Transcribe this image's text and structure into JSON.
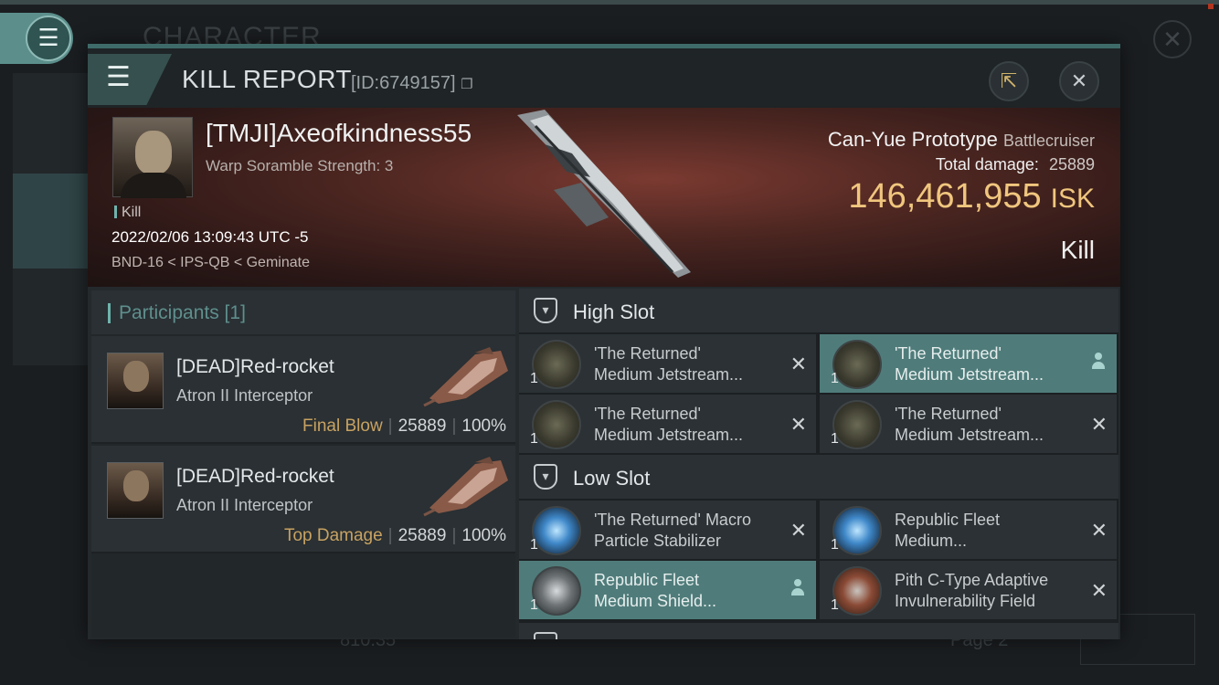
{
  "background": {
    "title": "CHARACTER",
    "ghost_value": "810.35",
    "ghost_page": "Page 2"
  },
  "header": {
    "title": "KILL REPORT",
    "id_label": "[ID:6749157]"
  },
  "victim": {
    "name": "[TMJI]Axeofkindness55",
    "detail": "Warp Soramble Strength: 3",
    "tag": "Kill",
    "datetime": "2022/02/06 13:09:43 UTC -5",
    "location": "BND-16 < IPS-QB < Geminate",
    "ship_name": "Can-Yue Prototype",
    "ship_class": "Battlecruiser",
    "total_damage_label": "Total damage:",
    "total_damage": "25889",
    "isk_value": "146,461,955",
    "isk_unit": "ISK",
    "result": "Kill"
  },
  "participants": {
    "header": "Participants [1]",
    "rows": [
      {
        "name": "[DEAD]Red-rocket",
        "ship": "Atron II Interceptor",
        "role": "Final Blow",
        "damage": "25889",
        "percent": "100%"
      },
      {
        "name": "[DEAD]Red-rocket",
        "ship": "Atron II Interceptor",
        "role": "Top Damage",
        "damage": "25889",
        "percent": "100%"
      }
    ]
  },
  "fitting": {
    "high_slot_label": "High Slot",
    "low_slot_label": "Low Slot",
    "high": [
      {
        "line1": "'The Returned'",
        "line2": "Medium Jetstream...",
        "qty": "1"
      },
      {
        "line1": "'The Returned'",
        "line2": "Medium Jetstream...",
        "qty": "1"
      },
      {
        "line1": "'The Returned'",
        "line2": "Medium Jetstream...",
        "qty": "1"
      },
      {
        "line1": "'The Returned'",
        "line2": "Medium Jetstream...",
        "qty": "1"
      }
    ],
    "low": [
      {
        "line1": "'The Returned' Macro",
        "line2": "Particle Stabilizer",
        "qty": "1"
      },
      {
        "line1": "Republic Fleet",
        "line2": "Medium...",
        "qty": "1"
      },
      {
        "line1": "Republic Fleet",
        "line2": "Medium Shield...",
        "qty": "1"
      },
      {
        "line1": "Pith C-Type Adaptive",
        "line2": "Invulnerability Field",
        "qty": "1"
      }
    ]
  },
  "colors": {
    "accent_teal": "#6fb3ad",
    "isk_gold": "#f0c67e",
    "role_gold": "#c8a262",
    "highlight_row": "#4f7c7a"
  }
}
